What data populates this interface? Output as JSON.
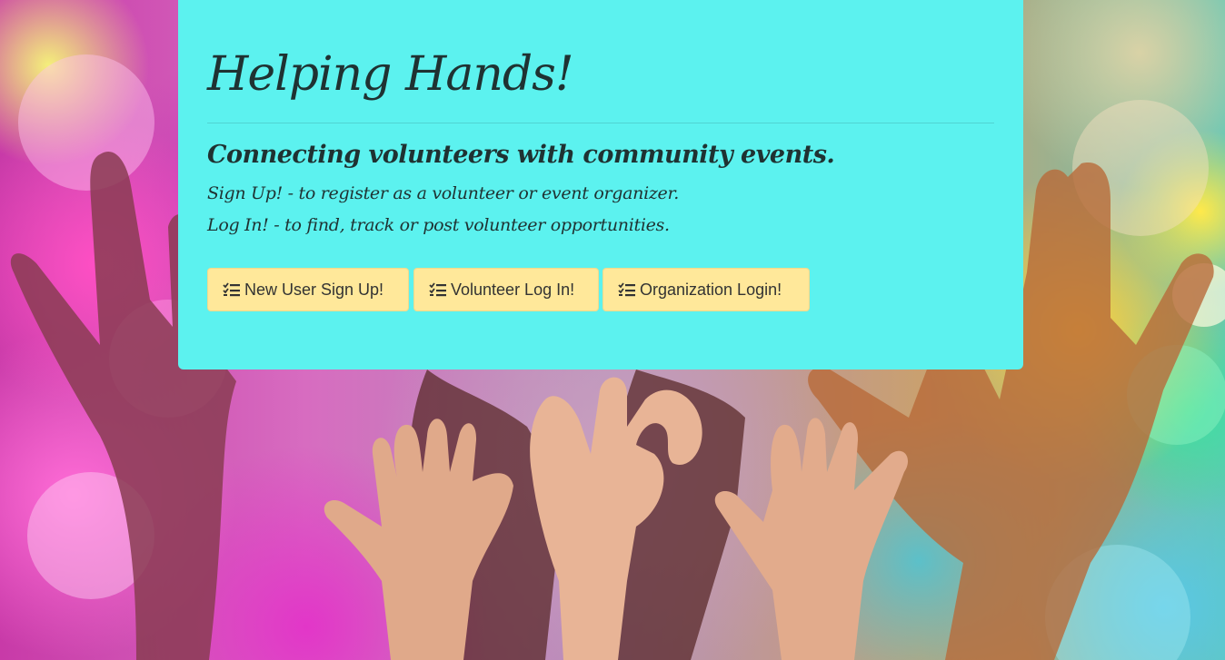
{
  "header": {
    "title": "Helping Hands!",
    "tagline": "Connecting volunteers with community events.",
    "signup_line": "Sign Up! - to register as a volunteer or event organizer.",
    "login_line": "Log In! - to find, track or post volunteer opportunities."
  },
  "buttons": {
    "signup_label": "New User Sign Up!",
    "volunteer_login_label": "Volunteer Log In!",
    "org_login_label": "Organization Login!",
    "icon": "tasks-list-icon"
  },
  "colors": {
    "panel": "#5cf2ef",
    "button": "#ffe89a",
    "text": "#1f3232"
  }
}
